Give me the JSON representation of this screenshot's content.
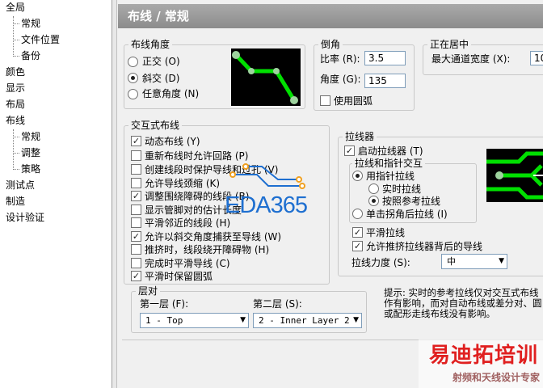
{
  "nav_tree": {
    "items": [
      {
        "label": "全局"
      },
      {
        "label": "常规"
      },
      {
        "label": "文件位置"
      },
      {
        "label": "备份"
      },
      {
        "label": "颜色"
      },
      {
        "label": "显示"
      },
      {
        "label": "布局"
      },
      {
        "label": "布线"
      },
      {
        "label": "常规"
      },
      {
        "label": "调整"
      },
      {
        "label": "策略"
      },
      {
        "label": "测试点"
      },
      {
        "label": "制造"
      },
      {
        "label": "设计验证"
      }
    ]
  },
  "header": {
    "title": "布线 / 常规"
  },
  "routing_angle": {
    "title": "布线角度",
    "options": [
      {
        "label": "正交 (O)",
        "selected": false
      },
      {
        "label": "斜交 (D)",
        "selected": true
      },
      {
        "label": "任意角度 (N)",
        "selected": false
      }
    ]
  },
  "chamfer": {
    "title": "倒角",
    "ratio_label": "比率 (R):",
    "ratio_value": "3.5",
    "angle_label": "角度 (G):",
    "angle_value": "135",
    "round_label": "使用圆弧",
    "round_checked": false
  },
  "centering": {
    "title": "正在居中",
    "max_channel_label": "最大通道宽度 (X):",
    "max_channel_value": "10"
  },
  "interactive": {
    "title": "交互式布线",
    "options": [
      {
        "label": "动态布线 (Y)",
        "checked": true
      },
      {
        "label": "重新布线时允许回路 (P)",
        "checked": false
      },
      {
        "label": "创建线段时保护导线和过孔 (V)",
        "checked": false
      },
      {
        "label": "允许导线颈缩 (K)",
        "checked": false
      },
      {
        "label": "调整围绕障碍的线段 (B)",
        "checked": true
      },
      {
        "label": "显示管脚对的估计长度",
        "checked": false
      },
      {
        "label": "平滑邻近的线段 (H)",
        "checked": false
      },
      {
        "label": "允许以斜交角度捕获至导线 (W)",
        "checked": true
      },
      {
        "label": "推挤时，线段绕开障碍物 (H)",
        "checked": false
      },
      {
        "label": "完成时平滑导线 (C)",
        "checked": false
      },
      {
        "label": "平滑时保留圆弧",
        "checked": true
      }
    ]
  },
  "stretcher": {
    "title": "拉线器",
    "enable_label": "启动拉线器 (T)",
    "enable_checked": true,
    "sub_title": "拉线和指针交互",
    "follow_label": "用指针拉线",
    "follow_selected": true,
    "realtime_label": "实时拉线",
    "realtime_selected": false,
    "reference_label": "按照参考拉线",
    "reference_selected": true,
    "click_label": "单击拐角后拉线 (I)",
    "click_selected": false,
    "smooth_label": "平滑拉线",
    "smooth_checked": true,
    "push_label": "允许推挤拉线器背后的导线",
    "push_checked": true,
    "strength_label": "拉线力度 (S):",
    "strength_value": "中"
  },
  "layer_pair": {
    "title": "层对",
    "first_label": "第一层 (F):",
    "first_value": "1 - Top",
    "second_label": "第二层 (S):",
    "second_value": "2 - Inner Layer 2"
  },
  "tip": {
    "line1": "提示: 实时的参考拉线仅对交互式布线",
    "line2": "作有影响，而对自动布线或差分对、圆",
    "line3": "或配形走线布线没有影响。"
  },
  "watermarks": {
    "eda": "EDA365",
    "brand": "易迪拓培训",
    "slogan": "射频和天线设计专家"
  },
  "colors": {
    "trace_green": "#00e000",
    "pad_gray": "#9ed39e",
    "brand_red": "#e02020"
  }
}
